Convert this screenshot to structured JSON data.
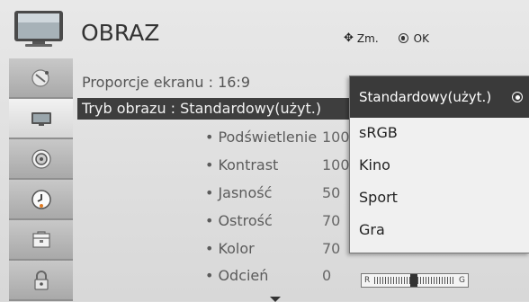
{
  "header": {
    "title": "OBRAZ",
    "move_hint": "Zm.",
    "ok_hint": "OK"
  },
  "sidebar": {
    "items": [
      {
        "icon": "picture-dish-icon"
      },
      {
        "icon": "tv-screen-icon",
        "active": true
      },
      {
        "icon": "speaker-icon"
      },
      {
        "icon": "clock-icon"
      },
      {
        "icon": "options-box-icon"
      },
      {
        "icon": "lock-icon"
      }
    ]
  },
  "menu": {
    "aspect_ratio": "Proporcje ekranu : 16:9",
    "picture_mode": "Tryb obrazu   : Standardowy(użyt.)",
    "settings": [
      {
        "label": "Podświetlenie",
        "value": "100"
      },
      {
        "label": "Kontrast",
        "value": "100"
      },
      {
        "label": "Jasność",
        "value": "50"
      },
      {
        "label": "Ostrość",
        "value": "70"
      },
      {
        "label": "Kolor",
        "value": "70"
      },
      {
        "label": "Odcień",
        "value": "0"
      }
    ]
  },
  "tint_slider": {
    "left_label": "R",
    "right_label": "G",
    "level": 0.5
  },
  "dropdown": {
    "options": [
      {
        "label": "Standardowy(użyt.)",
        "selected": true
      },
      {
        "label": "sRGB"
      },
      {
        "label": "Kino"
      },
      {
        "label": "Sport"
      },
      {
        "label": "Gra"
      }
    ]
  }
}
